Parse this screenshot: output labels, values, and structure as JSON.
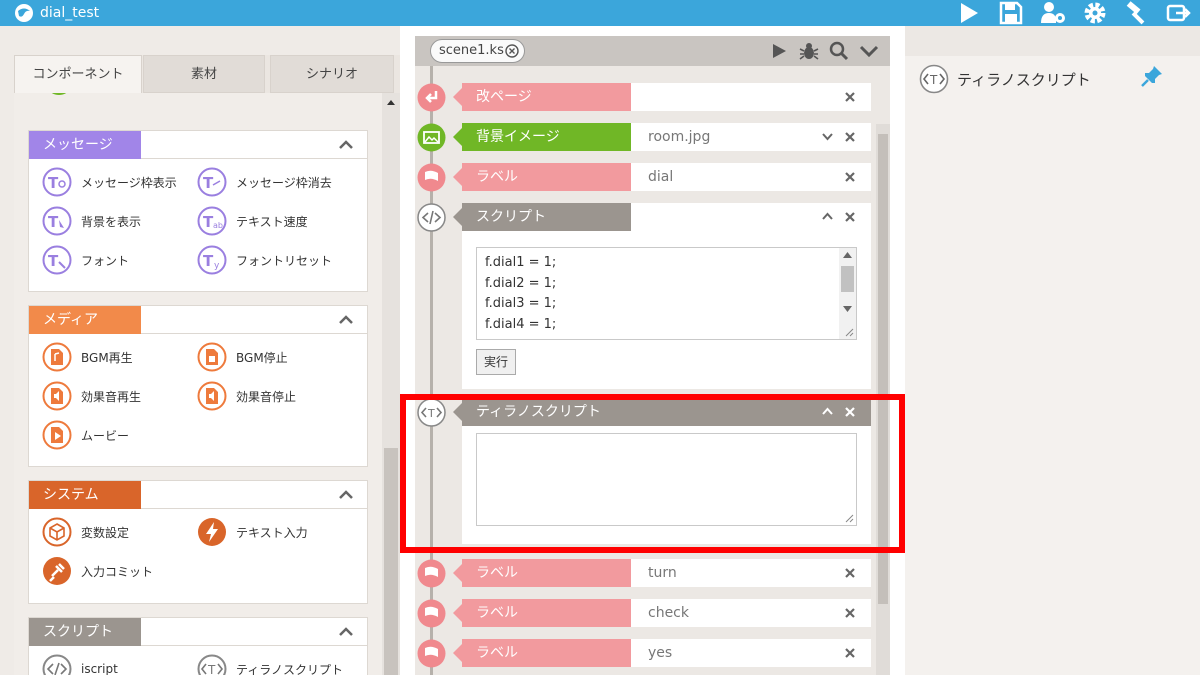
{
  "app": {
    "title": "dial_test"
  },
  "palette": {
    "tabs": [
      "コンポーネント",
      "素材",
      "シナリオ"
    ],
    "sections": [
      {
        "label": "メッセージ",
        "color": "#a185e8",
        "items": [
          "メッセージ枠表示",
          "メッセージ枠消去",
          "背景を表示",
          "テキスト速度",
          "フォント",
          "フォントリセット"
        ]
      },
      {
        "label": "メディア",
        "color": "#f28a4a",
        "items": [
          "BGM再生",
          "BGM停止",
          "効果音再生",
          "効果音停止",
          "ムービー"
        ]
      },
      {
        "label": "システム",
        "color": "#d9652a",
        "items": [
          "変数設定",
          "テキスト入力",
          "入力コミット"
        ]
      },
      {
        "label": "スクリプト",
        "color": "#9b958f",
        "items": [
          "iscript",
          "ティラノスクリプト"
        ]
      }
    ]
  },
  "editor": {
    "scene_tab": "scene1.ks",
    "rows": [
      {
        "label": "改ページ",
        "value": "",
        "color": "#f29a9e"
      },
      {
        "label": "背景イメージ",
        "value": "room.jpg",
        "color": "#70b726"
      },
      {
        "label": "ラベル",
        "value": "dial",
        "color": "#f29a9e"
      },
      {
        "label": "ラベル",
        "value": "turn",
        "color": "#f29a9e"
      },
      {
        "label": "ラベル",
        "value": "check",
        "color": "#f29a9e"
      },
      {
        "label": "ラベル",
        "value": "yes",
        "color": "#f29a9e"
      }
    ],
    "script_block": {
      "label": "スクリプト",
      "code": [
        "f.dial1 = 1;",
        "f.dial2 = 1;",
        "f.dial3 = 1;",
        "f.dial4 = 1;"
      ],
      "run_label": "実行"
    },
    "tyrano_block": {
      "label": "ティラノスクリプト",
      "content": ""
    }
  },
  "right_panel": {
    "title": "ティラノスクリプト"
  },
  "colors": {
    "accent": "#3ba6db",
    "highlight": "#ff0000"
  }
}
